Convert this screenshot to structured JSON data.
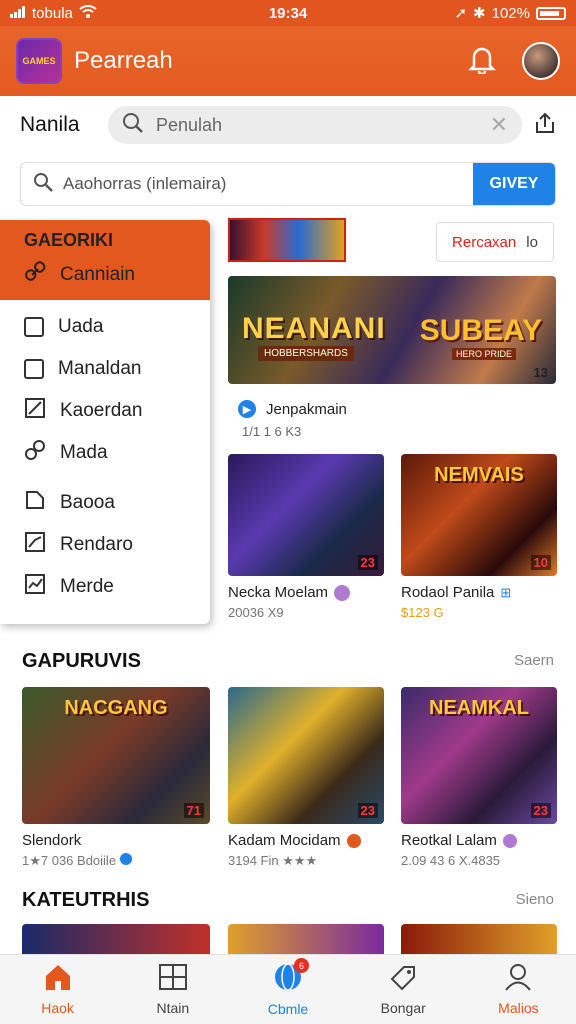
{
  "status": {
    "carrier": "tobula",
    "time": "19:34",
    "battery": "102%"
  },
  "header": {
    "logo_text": "GAMES",
    "title": "Pearreah"
  },
  "search_row": {
    "label": "Nanila",
    "placeholder": "Penulah"
  },
  "query_row": {
    "placeholder": "Aaohorras (inlemaira)",
    "button": "GIVEY"
  },
  "sidebar": {
    "heading": "GAEORIKI",
    "items": [
      {
        "label": "Canniain",
        "icon": "link-icon"
      },
      {
        "label": "Uada",
        "icon": "square-icon"
      },
      {
        "label": "Manaldan",
        "icon": "square-icon"
      },
      {
        "label": "Kaoerdan",
        "icon": "slash-square-icon"
      },
      {
        "label": "Mada",
        "icon": "link-icon"
      },
      {
        "label": "Baooa",
        "icon": "doc-icon"
      },
      {
        "label": "Rendaro",
        "icon": "trend-icon"
      },
      {
        "label": "Merde",
        "icon": "chart-icon"
      }
    ]
  },
  "filter_button": {
    "label": "Rercaxan",
    "suffix": "lo"
  },
  "hero": {
    "title_left": "NEANANI",
    "title_right": "SUBEAY",
    "sub_left": "HOBBERSHARDS",
    "sub_right": "HERO PRIDE",
    "badge": "13",
    "name": "Jenpakmain",
    "meta": "1/1 1 6 K3"
  },
  "featured": [
    {
      "title": "Necka Moelam",
      "meta": "20036 X9",
      "badge": "23"
    },
    {
      "title": "Rodaol Panila",
      "meta": "$123 G",
      "badge": "10",
      "art_title": "NEMVAIS"
    }
  ],
  "section1": {
    "heading": "GAPURUVIS",
    "see_more": "Saern"
  },
  "section1_cards": [
    {
      "title": "Slendork",
      "meta": "1★7 036 Bdoiile",
      "badge": "71",
      "art_title": "NACGANG"
    },
    {
      "title": "Kadam Mocidam",
      "meta": "3194 Fin ★★★",
      "badge": "23"
    },
    {
      "title": "Reotkal Lalam",
      "meta": "2.09 43 6 X.4835",
      "badge": "23",
      "art_title": "NEAMKAL"
    }
  ],
  "section2": {
    "heading": "KATEUTRHIS",
    "see_more": "Sieno"
  },
  "tabs": [
    {
      "label": "Haok",
      "icon": "home-icon"
    },
    {
      "label": "Ntain",
      "icon": "grid-icon"
    },
    {
      "label": "Cbmle",
      "icon": "globe-icon",
      "badge": "6"
    },
    {
      "label": "Bongar",
      "icon": "tag-icon"
    },
    {
      "label": "Malios",
      "icon": "user-icon"
    }
  ],
  "colors": {
    "primary": "#e3581f",
    "accent": "#1e82e6"
  }
}
